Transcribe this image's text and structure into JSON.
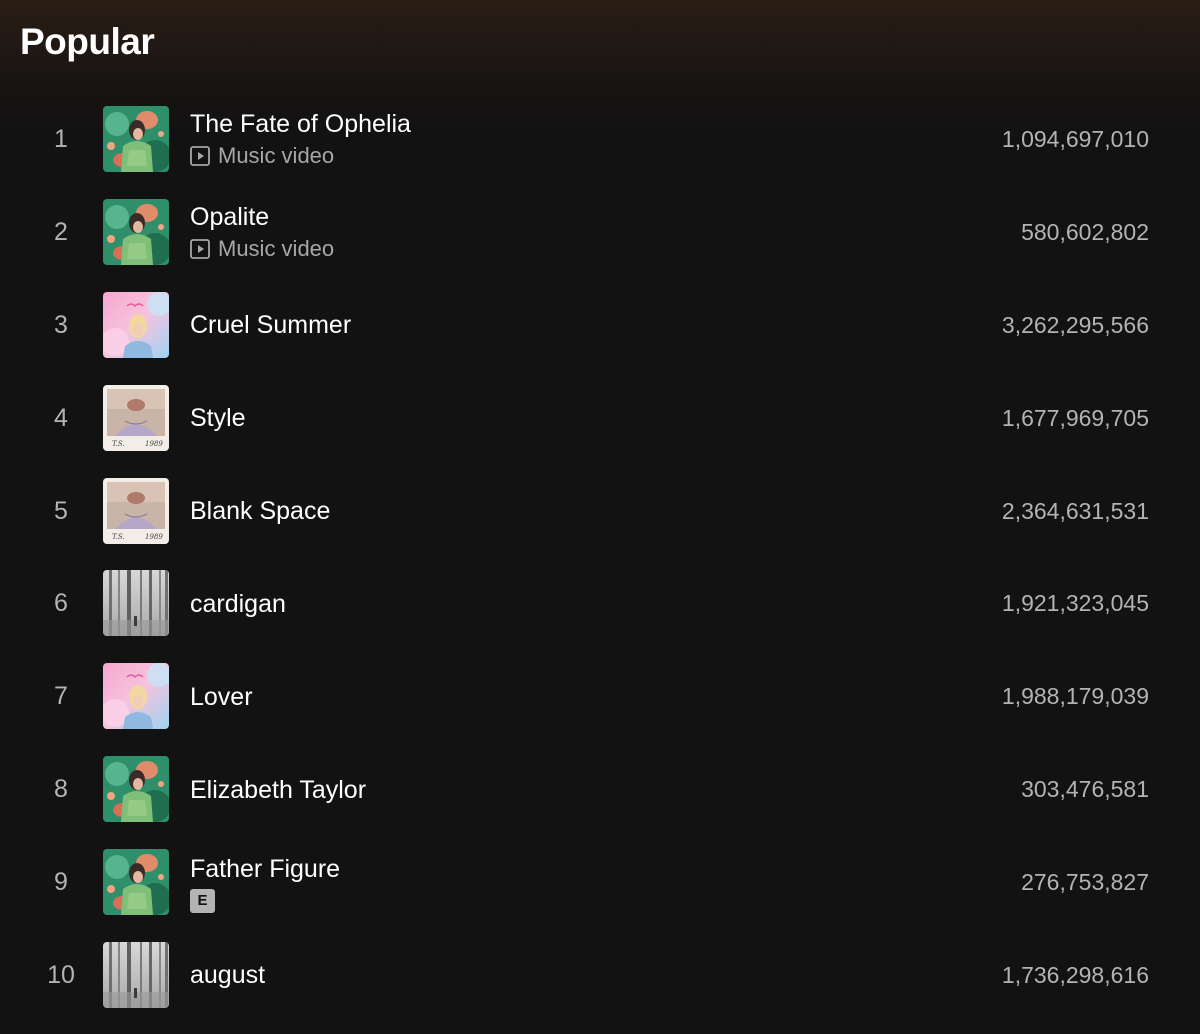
{
  "section": {
    "title": "Popular"
  },
  "tracks": [
    {
      "index": "1",
      "title": "The Fate of Ophelia",
      "subtitle": "Music video",
      "explicit": "",
      "plays": "1,094,697,010",
      "cover": "showgirl-cover"
    },
    {
      "index": "2",
      "title": "Opalite",
      "subtitle": "Music video",
      "explicit": "",
      "plays": "580,602,802",
      "cover": "showgirl-cover"
    },
    {
      "index": "3",
      "title": "Cruel Summer",
      "subtitle": "",
      "explicit": "",
      "plays": "3,262,295,566",
      "cover": "lover-cover"
    },
    {
      "index": "4",
      "title": "Style",
      "subtitle": "",
      "explicit": "",
      "plays": "1,677,969,705",
      "cover": "1989-cover"
    },
    {
      "index": "5",
      "title": "Blank Space",
      "subtitle": "",
      "explicit": "",
      "plays": "2,364,631,531",
      "cover": "1989-cover"
    },
    {
      "index": "6",
      "title": "cardigan",
      "subtitle": "",
      "explicit": "",
      "plays": "1,921,323,045",
      "cover": "folklore-cover"
    },
    {
      "index": "7",
      "title": "Lover",
      "subtitle": "",
      "explicit": "",
      "plays": "1,988,179,039",
      "cover": "lover-cover"
    },
    {
      "index": "8",
      "title": "Elizabeth Taylor",
      "subtitle": "",
      "explicit": "",
      "plays": "303,476,581",
      "cover": "showgirl-cover"
    },
    {
      "index": "9",
      "title": "Father Figure",
      "subtitle": "",
      "explicit": "E",
      "plays": "276,753,827",
      "cover": "showgirl-cover"
    },
    {
      "index": "10",
      "title": "august",
      "subtitle": "",
      "explicit": "",
      "plays": "1,736,298,616",
      "cover": "folklore-cover"
    }
  ],
  "icons": {
    "music_video": "play-square-icon",
    "explicit": "explicit-badge"
  },
  "colors": {
    "background": "#121212",
    "header_gradient_top": "#2a1d14",
    "text_primary": "#ffffff",
    "text_secondary": "#b3b3b3",
    "explicit_badge_bg": "#b3b3b3"
  }
}
